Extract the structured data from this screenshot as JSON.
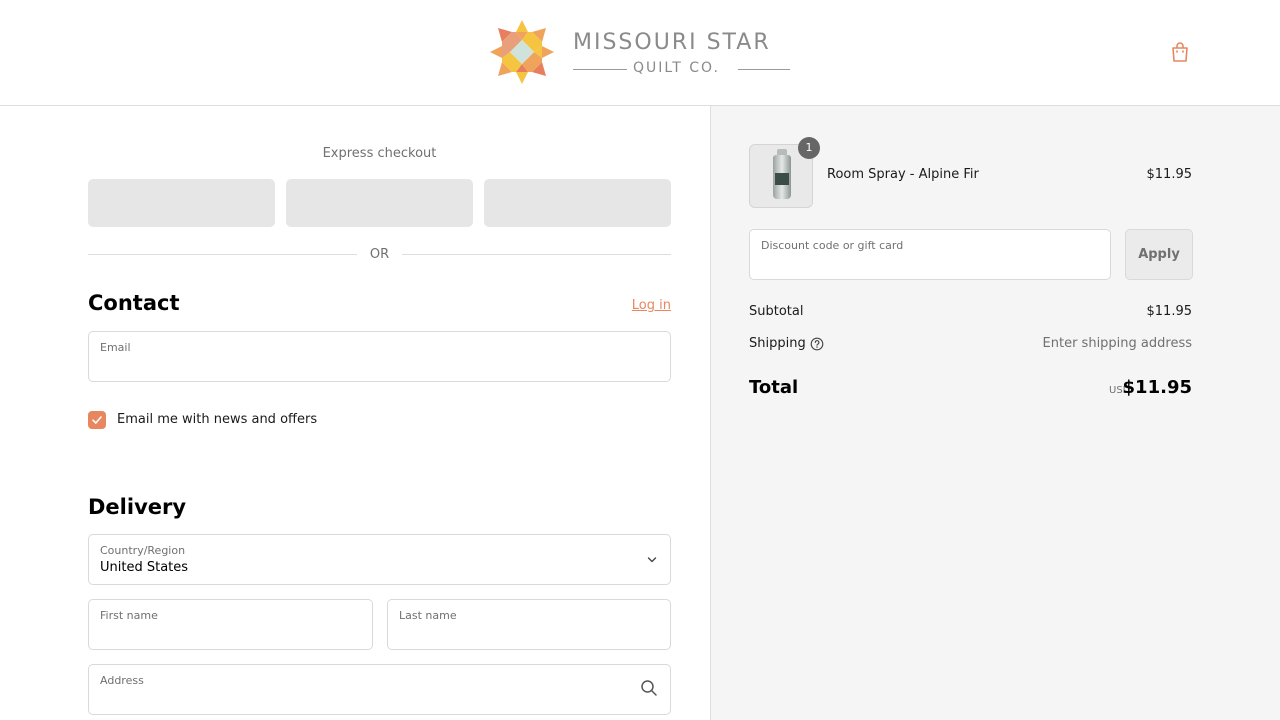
{
  "header": {
    "brand_name": "MISSOURI STAR",
    "brand_sub": "QUILT CO.",
    "cart_icon": "shopping-bag-icon"
  },
  "colors": {
    "accent": "#e8865f",
    "logo_orange": "#f0a35a",
    "logo_yellow": "#f5c542",
    "logo_coral": "#e77e5d",
    "logo_mint": "#cfe3da"
  },
  "express": {
    "title": "Express checkout",
    "divider": "OR"
  },
  "contact": {
    "heading": "Contact",
    "login_label": "Log in",
    "email_label": "Email",
    "email_value": "",
    "newsletter_label": "Email me with news and offers",
    "newsletter_checked": true
  },
  "delivery": {
    "heading": "Delivery",
    "country_label": "Country/Region",
    "country_value": "United States",
    "first_name_label": "First name",
    "last_name_label": "Last name",
    "address_label": "Address"
  },
  "summary": {
    "item": {
      "name": "Room Spray - Alpine Fir",
      "price": "$11.95",
      "quantity": "1"
    },
    "discount_label": "Discount code or gift card",
    "apply_label": "Apply",
    "subtotal_label": "Subtotal",
    "subtotal_value": "$11.95",
    "shipping_label": "Shipping",
    "shipping_value": "Enter shipping address",
    "total_label": "Total",
    "currency": "USD",
    "total_value": "$11.95"
  }
}
